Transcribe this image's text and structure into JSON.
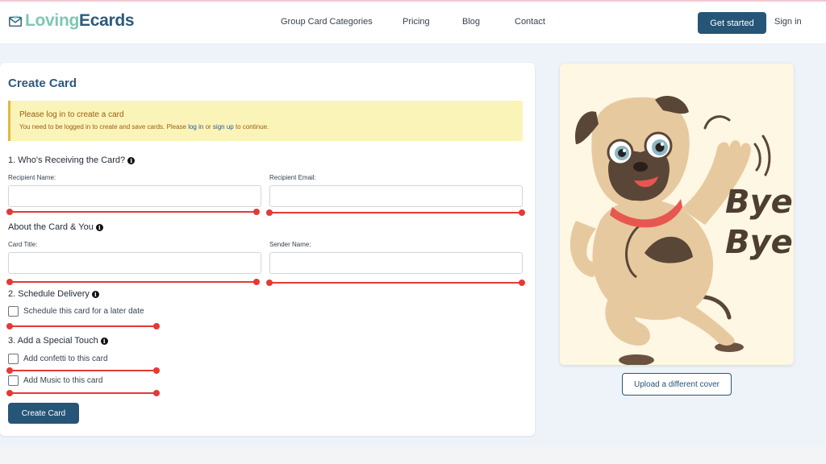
{
  "brand": {
    "logo_part1": "Loving",
    "logo_part2": "Ecards"
  },
  "nav": {
    "items": [
      "Group Card Categories",
      "Pricing",
      "Blog",
      "Contact"
    ],
    "get_started": "Get started",
    "sign_in": "Sign in"
  },
  "form": {
    "title": "Create Card",
    "alert": {
      "title": "Please log in to create a card",
      "text_before": "You need to be logged in to create and save cards. Please",
      "login_link": "log in",
      "text_or": "or",
      "signup_link": "sign up",
      "text_after": "to continue."
    },
    "section1": "1. Who's Receiving the Card?",
    "recipient_name_label": "Recipient Name:",
    "recipient_email_label": "Recipient Email:",
    "section_about": "About the Card & You",
    "card_title_label": "Card Title:",
    "sender_name_label": "Sender Name:",
    "section2": "2. Schedule Delivery",
    "schedule_label": "Schedule this card for a later date",
    "section3": "3. Add a Special Touch",
    "confetti_label": "Add confetti to this card",
    "music_label": "Add Music to this card",
    "create_button": "Create Card"
  },
  "cover": {
    "bye_line1": "Bye",
    "bye_line2": "Bye",
    "upload_button": "Upload a different cover"
  },
  "colors": {
    "primary": "#255577",
    "accent_teal": "#7fc6b4",
    "alert_bg": "#fbf4b9",
    "slider_red": "#e53935"
  },
  "icons": [
    "envelope-heart-icon",
    "info-icon"
  ]
}
